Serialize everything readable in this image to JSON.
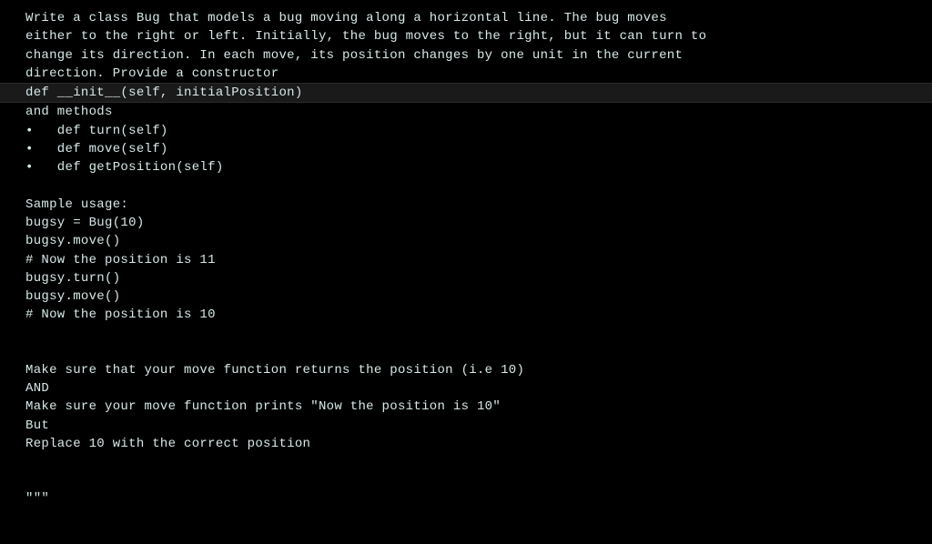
{
  "lines": [
    {
      "text": "Write a class Bug that models a bug moving along a horizontal line. The bug moves",
      "highlighted": false
    },
    {
      "text": "either to the right or left. Initially, the bug moves to the right, but it can turn to",
      "highlighted": false
    },
    {
      "text": "change its direction. In each move, its position changes by one unit in the current",
      "highlighted": false
    },
    {
      "text": "direction. Provide a constructor",
      "highlighted": false
    },
    {
      "text": "def __init__(self, initialPosition)",
      "highlighted": true
    },
    {
      "text": "and methods",
      "highlighted": false
    },
    {
      "text": "•   def turn(self)",
      "highlighted": false
    },
    {
      "text": "•   def move(self)",
      "highlighted": false
    },
    {
      "text": "•   def getPosition(self)",
      "highlighted": false
    },
    {
      "text": "",
      "highlighted": false
    },
    {
      "text": "Sample usage:",
      "highlighted": false
    },
    {
      "text": "bugsy = Bug(10)",
      "highlighted": false
    },
    {
      "text": "bugsy.move()",
      "highlighted": false
    },
    {
      "text": "# Now the position is 11",
      "highlighted": false
    },
    {
      "text": "bugsy.turn()",
      "highlighted": false
    },
    {
      "text": "bugsy.move()",
      "highlighted": false
    },
    {
      "text": "# Now the position is 10",
      "highlighted": false
    },
    {
      "text": "",
      "highlighted": false
    },
    {
      "text": "",
      "highlighted": false
    },
    {
      "text": "Make sure that your move function returns the position (i.e 10)",
      "highlighted": false
    },
    {
      "text": "AND",
      "highlighted": false
    },
    {
      "text": "Make sure your move function prints \"Now the position is 10\"",
      "highlighted": false
    },
    {
      "text": "But",
      "highlighted": false
    },
    {
      "text": "Replace 10 with the correct position",
      "highlighted": false
    },
    {
      "text": "",
      "highlighted": false
    },
    {
      "text": "",
      "highlighted": false
    },
    {
      "text": "\"\"\"",
      "highlighted": false
    }
  ]
}
